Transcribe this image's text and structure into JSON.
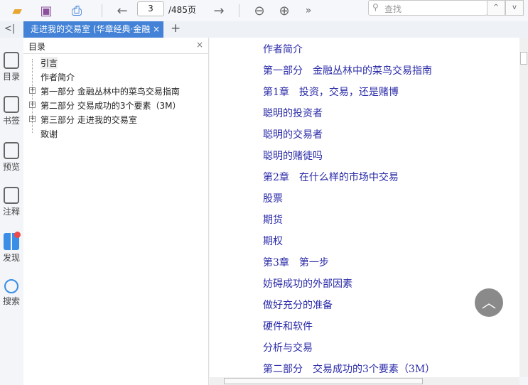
{
  "toolbar": {
    "page_current": "3",
    "page_total": "/485页",
    "search_placeholder": "查找",
    "more": "»",
    "up": "^",
    "down": "v"
  },
  "tab": {
    "title": "走进我的交易室 (华章经典·金融",
    "close": "×",
    "add": "+",
    "collapse": "<|"
  },
  "rail": [
    {
      "label": "目录"
    },
    {
      "label": "书签"
    },
    {
      "label": "预览"
    },
    {
      "label": "注释"
    },
    {
      "label": "发现"
    },
    {
      "label": "搜索"
    }
  ],
  "toc": {
    "title": "目录",
    "close": "×",
    "items": [
      {
        "label": "引言",
        "expandable": false
      },
      {
        "label": "作者简介",
        "expandable": false
      },
      {
        "label": "第一部分 金融丛林中的菜鸟交易指南",
        "expandable": true
      },
      {
        "label": "第二部分 交易成功的3个要素（3M）",
        "expandable": true
      },
      {
        "label": "第三部分 走进我的交易室",
        "expandable": true
      },
      {
        "label": "致谢",
        "expandable": false
      }
    ]
  },
  "content": {
    "lines": [
      "作者简介",
      "第一部分　金融丛林中的菜鸟交易指南",
      "第1章　投资，交易，还是赌博",
      "聪明的投资者",
      "聪明的交易者",
      "聪明的赌徒吗",
      "第2章　在什么样的市场中交易",
      "股票",
      "期货",
      "期权",
      "第3章　第一步",
      "妨碍成功的外部因素",
      "做好充分的准备",
      "硬件和软件",
      "分析与交易",
      "第二部分　交易成功的3个要素（3M）"
    ]
  }
}
